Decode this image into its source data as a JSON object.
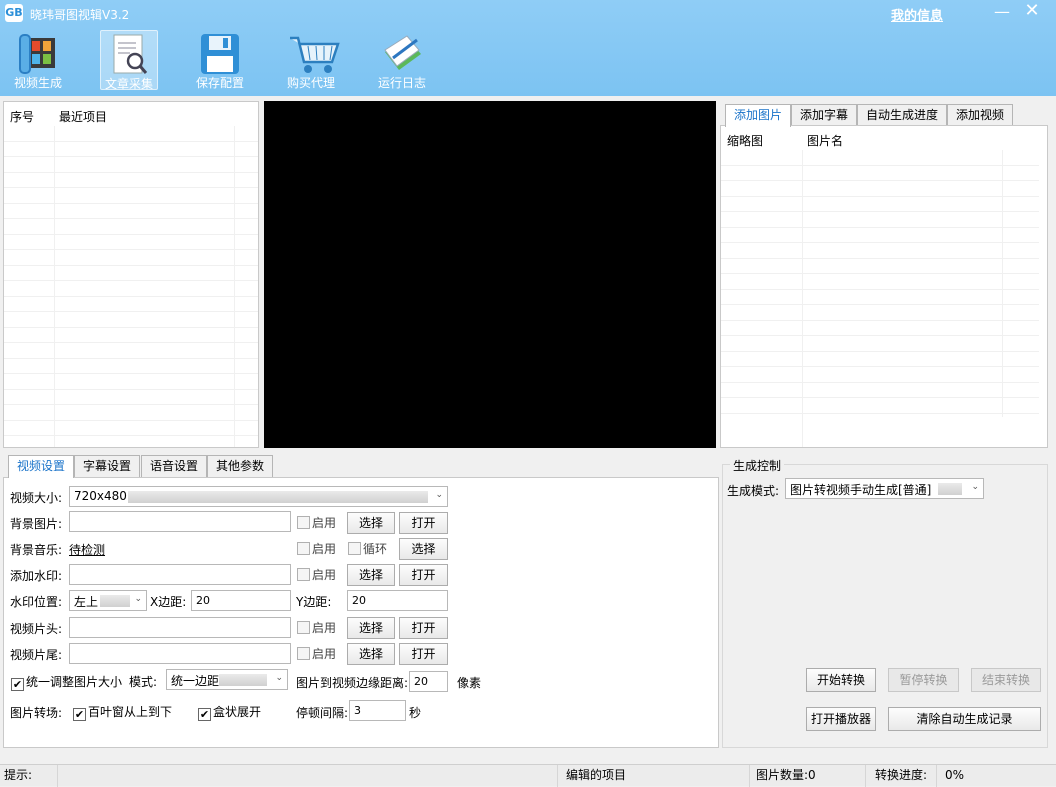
{
  "window": {
    "title": "晓玮哥图视辑V3.2",
    "app_icon_text": "GB",
    "my_info": "我的信息",
    "minimize_glyph": "—",
    "close_glyph": "✕"
  },
  "toolbar": [
    {
      "label": "视频生成",
      "icon": "film-icon"
    },
    {
      "label": "文章采集",
      "icon": "document-search-icon",
      "active": true
    },
    {
      "label": "保存配置",
      "icon": "floppy-disk-icon"
    },
    {
      "label": "购买代理",
      "icon": "shopping-cart-icon"
    },
    {
      "label": "运行日志",
      "icon": "notebook-pen-icon"
    }
  ],
  "recent_panel": {
    "col_index": "序号",
    "col_recent": "最近项目"
  },
  "right_panel": {
    "tabs": [
      "添加图片",
      "添加字幕",
      "自动生成进度",
      "添加视频"
    ],
    "col_thumb": "缩略图",
    "col_name": "图片名"
  },
  "settings": {
    "tabs": [
      "视频设置",
      "字幕设置",
      "语音设置",
      "其他参数"
    ],
    "video_size_label": "视频大小:",
    "video_size_value": "720x480",
    "bg_image_label": "背景图片:",
    "bg_music_label": "背景音乐:",
    "bg_music_value": "待检测",
    "watermark_label": "添加水印:",
    "watermark_pos_label": "水印位置:",
    "watermark_pos_value": "左上",
    "x_margin_label": "X边距:",
    "x_margin_value": "20",
    "y_margin_label": "Y边距:",
    "y_margin_value": "20",
    "intro_label": "视频片头:",
    "outro_label": "视频片尾:",
    "enable": "启用",
    "loop": "循环",
    "choose": "选择",
    "open": "打开",
    "resize_label": "统一调整图片大小",
    "mode_label": "模式:",
    "mode_value": "统一边距",
    "edge_dist_label": "图片到视频边缘距离:",
    "edge_dist_value": "20",
    "pixel_unit": "像素",
    "transition_label": "图片转场:",
    "transition_1": "百叶窗从上到下",
    "transition_2": "盒状展开",
    "pause_label": "停顿间隔:",
    "pause_value": "3",
    "seconds_unit": "秒"
  },
  "control": {
    "group_title": "生成控制",
    "mode_label": "生成模式:",
    "mode_value": "图片转视频手动生成[普通]",
    "start": "开始转换",
    "pause": "暂停转换",
    "stop": "结束转换",
    "open_player": "打开播放器",
    "clear_records": "清除自动生成记录"
  },
  "status": {
    "hint_label": "提示:",
    "edited_project": "编辑的项目",
    "image_count": "图片数量:0",
    "progress": "转换进度:",
    "progress_value": "0%"
  },
  "colors": {
    "header": "#8fcdf6",
    "active_tab_text": "#1a73c9"
  }
}
